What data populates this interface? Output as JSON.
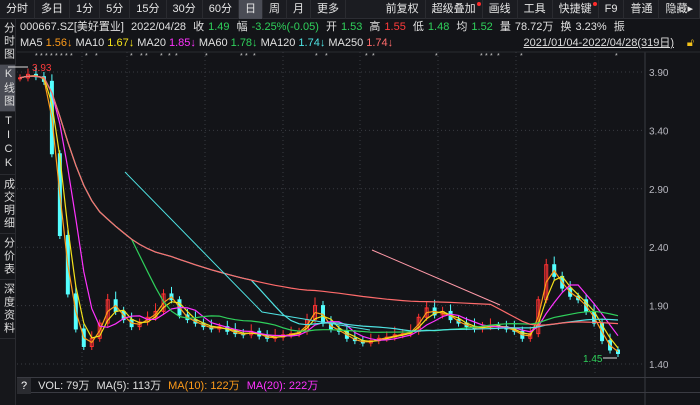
{
  "toolbar": {
    "tabs": [
      "分时",
      "多日",
      "1分",
      "5分",
      "15分",
      "30分",
      "60分",
      "日",
      "周",
      "月",
      "更多"
    ],
    "active": "日",
    "right": [
      {
        "label": "前复权",
        "dot": false
      },
      {
        "label": "超级叠加",
        "dot": true
      },
      {
        "label": "画线",
        "dot": false
      },
      {
        "label": "工具",
        "dot": false
      },
      {
        "label": "快捷键",
        "dot": true
      },
      {
        "label": "F9",
        "dot": false
      },
      {
        "label": "普通",
        "dot": false
      },
      {
        "label": "隐藏▸",
        "dot": false
      }
    ]
  },
  "sidebar": [
    {
      "label": "分时图",
      "active": false
    },
    {
      "label": "K线图",
      "active": true
    },
    {
      "label": "TICK",
      "active": false
    },
    {
      "label": "成交明细",
      "active": false
    },
    {
      "label": "分价表",
      "active": false
    },
    {
      "label": "深度资料",
      "active": false
    }
  ],
  "quote": {
    "code": "000667.SZ[美好置业]",
    "date": "2022/04/28",
    "close_label": "收",
    "close": "1.49",
    "chg_label": "幅",
    "chg": "-3.25%(-0.05)",
    "open_label": "开",
    "open": "1.53",
    "high_label": "高",
    "high": "1.55",
    "low_label": "低",
    "low": "1.48",
    "avg_label": "均",
    "avg": "1.52",
    "vol_label": "量",
    "vol": "78.72万",
    "turn_label": "换",
    "turn": "3.23%",
    "amp_label": "振"
  },
  "ma": [
    {
      "name": "MA5",
      "value": "1.56↓",
      "color": "#ff9c1a"
    },
    {
      "name": "MA10",
      "value": "1.67↓",
      "color": "#f4e11a"
    },
    {
      "name": "MA20",
      "value": "1.85↓",
      "color": "#ff33ff"
    },
    {
      "name": "MA60",
      "value": "1.78↓",
      "color": "#2fd05b"
    },
    {
      "name": "MA120",
      "value": "1.74↓",
      "color": "#4fe3e3"
    },
    {
      "name": "MA250",
      "value": "1.74↓",
      "color": "#ff6b6b"
    }
  ],
  "range": "2021/01/04-2022/04/28(319日)",
  "volume": {
    "help": "?",
    "vol": "VOL: 79万",
    "ma5": "MA(5): 113万",
    "ma10": "MA(10): 122万",
    "ma20": "MA(20): 222万"
  },
  "chart_data": {
    "type": "candlestick",
    "yticks": [
      "3.90",
      "3.40",
      "2.90",
      "2.40",
      "1.90",
      "1.40"
    ],
    "ylim": [
      1.4,
      3.9
    ],
    "max_label": "3.93",
    "min_label": "1.45",
    "closes": [
      3.85,
      3.88,
      3.86,
      3.82,
      3.2,
      2.5,
      2.0,
      1.7,
      1.55,
      1.62,
      1.75,
      1.95,
      1.85,
      1.78,
      1.72,
      1.76,
      1.8,
      1.85,
      2.0,
      1.95,
      1.82,
      1.78,
      1.75,
      1.72,
      1.7,
      1.72,
      1.68,
      1.66,
      1.65,
      1.68,
      1.64,
      1.62,
      1.63,
      1.65,
      1.66,
      1.68,
      1.78,
      1.9,
      1.75,
      1.7,
      1.68,
      1.62,
      1.6,
      1.58,
      1.6,
      1.62,
      1.63,
      1.65,
      1.66,
      1.68,
      1.8,
      1.88,
      1.82,
      1.85,
      1.78,
      1.75,
      1.72,
      1.7,
      1.72,
      1.73,
      1.72,
      1.7,
      1.68,
      1.62,
      1.66,
      1.95,
      2.25,
      2.15,
      2.05,
      1.98,
      1.95,
      1.85,
      1.75,
      1.6,
      1.52,
      1.49
    ],
    "ma_windows": [
      2,
      3,
      5,
      15,
      30,
      60
    ],
    "up_color": "#ff3232",
    "down_color": "#54ffff"
  }
}
